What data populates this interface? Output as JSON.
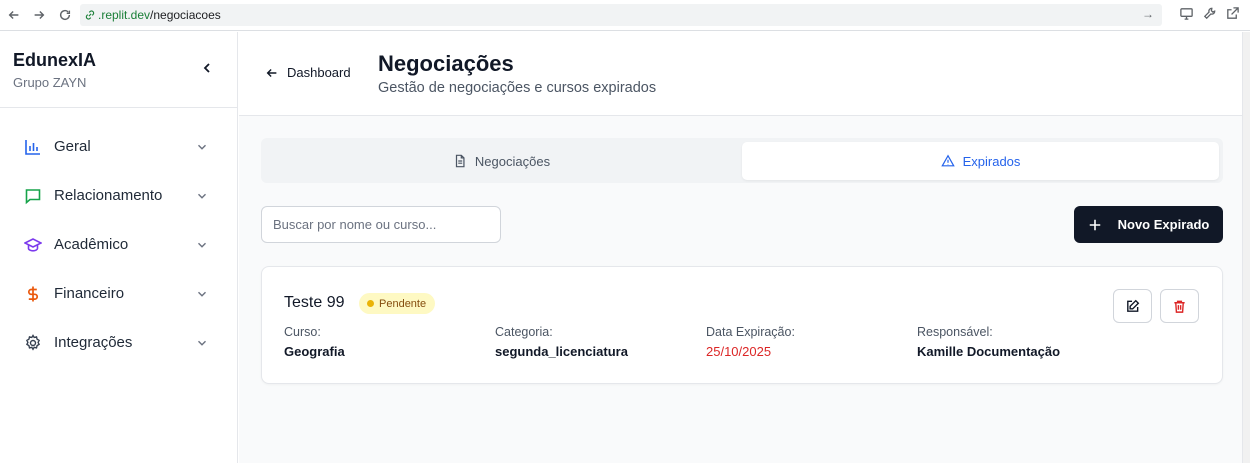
{
  "browser": {
    "url_host": ".replit.dev",
    "url_path": "/negociacoes"
  },
  "sidebar": {
    "brand": "EdunexIA",
    "subtitle": "Grupo ZAYN",
    "items": [
      {
        "label": "Geral",
        "icon": "bar-chart-icon",
        "color": "#2563eb"
      },
      {
        "label": "Relacionamento",
        "icon": "message-icon",
        "color": "#16a34a"
      },
      {
        "label": "Acadêmico",
        "icon": "graduation-cap-icon",
        "color": "#7c3aed"
      },
      {
        "label": "Financeiro",
        "icon": "dollar-icon",
        "color": "#ea580c"
      },
      {
        "label": "Integrações",
        "icon": "gear-icon",
        "color": "#374151"
      }
    ]
  },
  "header": {
    "back_label": "Dashboard",
    "title": "Negociações",
    "subtitle": "Gestão de negociações e cursos expirados"
  },
  "tabs": [
    {
      "label": "Negociações",
      "icon": "document-icon",
      "active": false
    },
    {
      "label": "Expirados",
      "icon": "warning-icon",
      "active": true
    }
  ],
  "toolbar": {
    "search_placeholder": "Buscar por nome ou curso...",
    "new_button": "Novo Expirado"
  },
  "cards": [
    {
      "title": "Teste 99",
      "status": "Pendente",
      "fields": [
        {
          "label": "Curso:",
          "value": "Geografia"
        },
        {
          "label": "Categoria:",
          "value": "segunda_licenciatura"
        },
        {
          "label": "Data Expiração:",
          "value": "25/10/2025"
        },
        {
          "label": "Responsável:",
          "value": "Kamille Documentação"
        }
      ]
    }
  ],
  "colors": {
    "accent": "#2563eb",
    "primary_button": "#111827",
    "danger": "#dc2626",
    "badge_bg": "#fef9c3"
  }
}
